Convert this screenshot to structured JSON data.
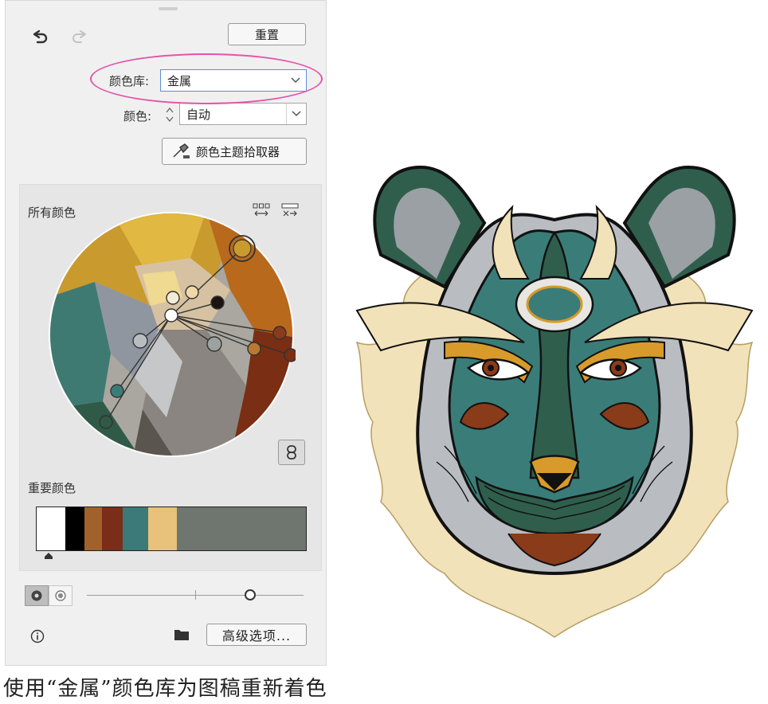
{
  "toolbar": {
    "reset_label": "重置"
  },
  "library": {
    "label": "颜色库:",
    "value": "金属"
  },
  "color": {
    "label": "颜色:",
    "value": "自动"
  },
  "picker": {
    "label": "颜色主题拾取器"
  },
  "wheel": {
    "title": "所有颜色"
  },
  "important": {
    "title": "重要颜色",
    "swatches": [
      "#ffffff",
      "#000000",
      "#a0622a",
      "#7a2e1a",
      "#3b7a78",
      "#e8c27a",
      "#6e766f"
    ]
  },
  "footer": {
    "advanced_label": "高级选项..."
  },
  "caption": "使用“金属”颜色库为图稿重新着色",
  "colors": {
    "teal_dark": "#2f5e4d",
    "teal": "#3a7d78",
    "gold": "#d89a2a",
    "rust": "#8a3b1a",
    "cream": "#f1e2b9",
    "gray": "#b9bcc0"
  }
}
